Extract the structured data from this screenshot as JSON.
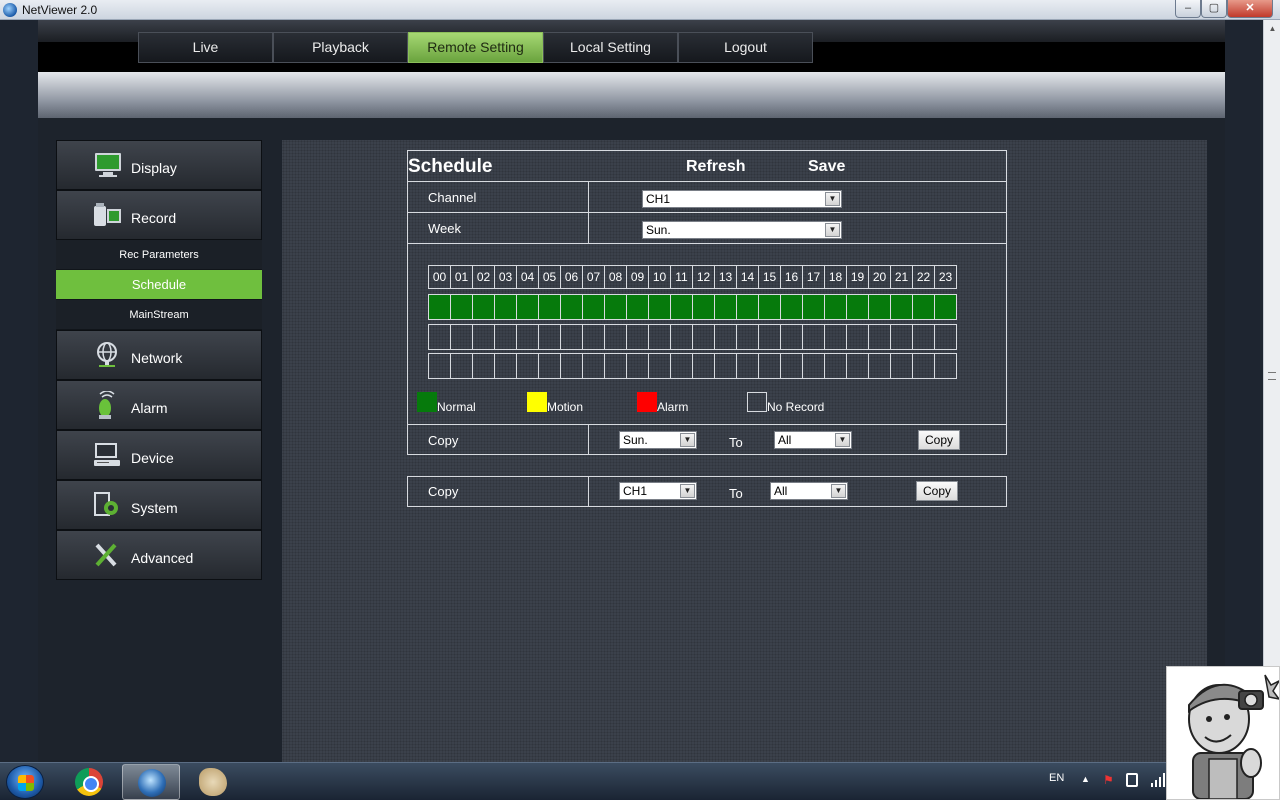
{
  "window": {
    "title": "NetViewer 2.0",
    "controls": [
      "–",
      "▢",
      "✕"
    ]
  },
  "nav": {
    "tabs": [
      "Live",
      "Playback",
      "Remote Setting",
      "Local Setting",
      "Logout"
    ],
    "active_index": 2
  },
  "sidebar": {
    "items": [
      {
        "label": "Display",
        "icon": "monitor-icon"
      },
      {
        "label": "Record",
        "icon": "recorder-icon",
        "subitems": [
          "Rec Parameters",
          "Schedule",
          "MainStream"
        ],
        "active_sub": 1
      },
      {
        "label": "Network",
        "icon": "globe-icon"
      },
      {
        "label": "Alarm",
        "icon": "alarm-siren-icon"
      },
      {
        "label": "Device",
        "icon": "computer-icon"
      },
      {
        "label": "System",
        "icon": "gear-icon"
      },
      {
        "label": "Advanced",
        "icon": "tools-icon"
      }
    ]
  },
  "schedule": {
    "title": "Schedule",
    "refresh_label": "Refresh",
    "save_label": "Save",
    "channel": {
      "label": "Channel",
      "value": "CH1"
    },
    "week": {
      "label": "Week",
      "value": "Sun."
    },
    "hours": [
      "00",
      "01",
      "02",
      "03",
      "04",
      "05",
      "06",
      "07",
      "08",
      "09",
      "10",
      "11",
      "12",
      "13",
      "14",
      "15",
      "16",
      "17",
      "18",
      "19",
      "20",
      "21",
      "22",
      "23"
    ],
    "rows": [
      {
        "state": "normal"
      },
      {
        "state": "none"
      },
      {
        "state": "none"
      }
    ],
    "legend": [
      {
        "label": "Normal",
        "color": "#067a0c"
      },
      {
        "label": "Motion",
        "color": "#ffff00"
      },
      {
        "label": "Alarm",
        "color": "#ff0000"
      },
      {
        "label": "No Record",
        "color": "none"
      }
    ],
    "copy_day": {
      "label": "Copy",
      "from": "Sun.",
      "to_label": "To",
      "to": "All",
      "button": "Copy"
    }
  },
  "copy_channel": {
    "label": "Copy",
    "from": "CH1",
    "to_label": "To",
    "to": "All",
    "button": "Copy"
  },
  "taskbar": {
    "apps": [
      "start-button",
      "chrome-icon",
      "netviewer-icon",
      "paint-icon"
    ],
    "tray": {
      "language": "EN",
      "show_hidden": "▲"
    }
  }
}
